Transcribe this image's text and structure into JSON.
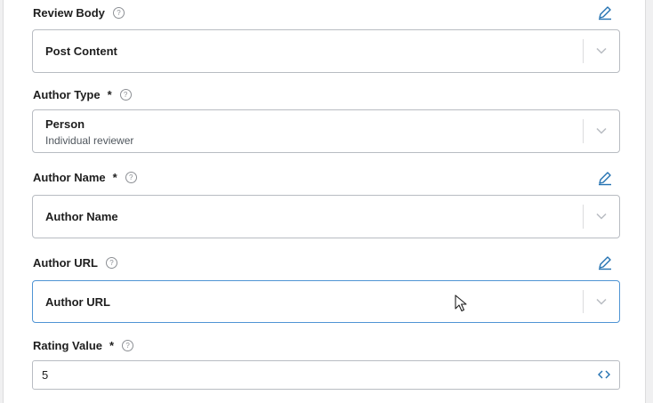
{
  "fields": {
    "review_body": {
      "label": "Review Body",
      "help": "?",
      "value": "Post Content"
    },
    "author_type": {
      "label": "Author Type",
      "required": "*",
      "help": "?",
      "value": "Person",
      "sublabel": "Individual reviewer"
    },
    "author_name": {
      "label": "Author Name",
      "required": "*",
      "help": "?",
      "value": "Author Name"
    },
    "author_url": {
      "label": "Author URL",
      "help": "?",
      "value": "Author URL"
    },
    "rating_value": {
      "label": "Rating Value",
      "required": "*",
      "help": "?",
      "value": "5"
    }
  },
  "icons": {
    "edit": "pencil-icon",
    "dropdown": "chevron-down-icon",
    "help": "question-circle-icon",
    "code": "code-brackets-icon"
  },
  "colors": {
    "accent": "#2271b1",
    "focus_border": "#4f94d4",
    "border": "#b8bcc2",
    "muted": "#8c8f94"
  }
}
